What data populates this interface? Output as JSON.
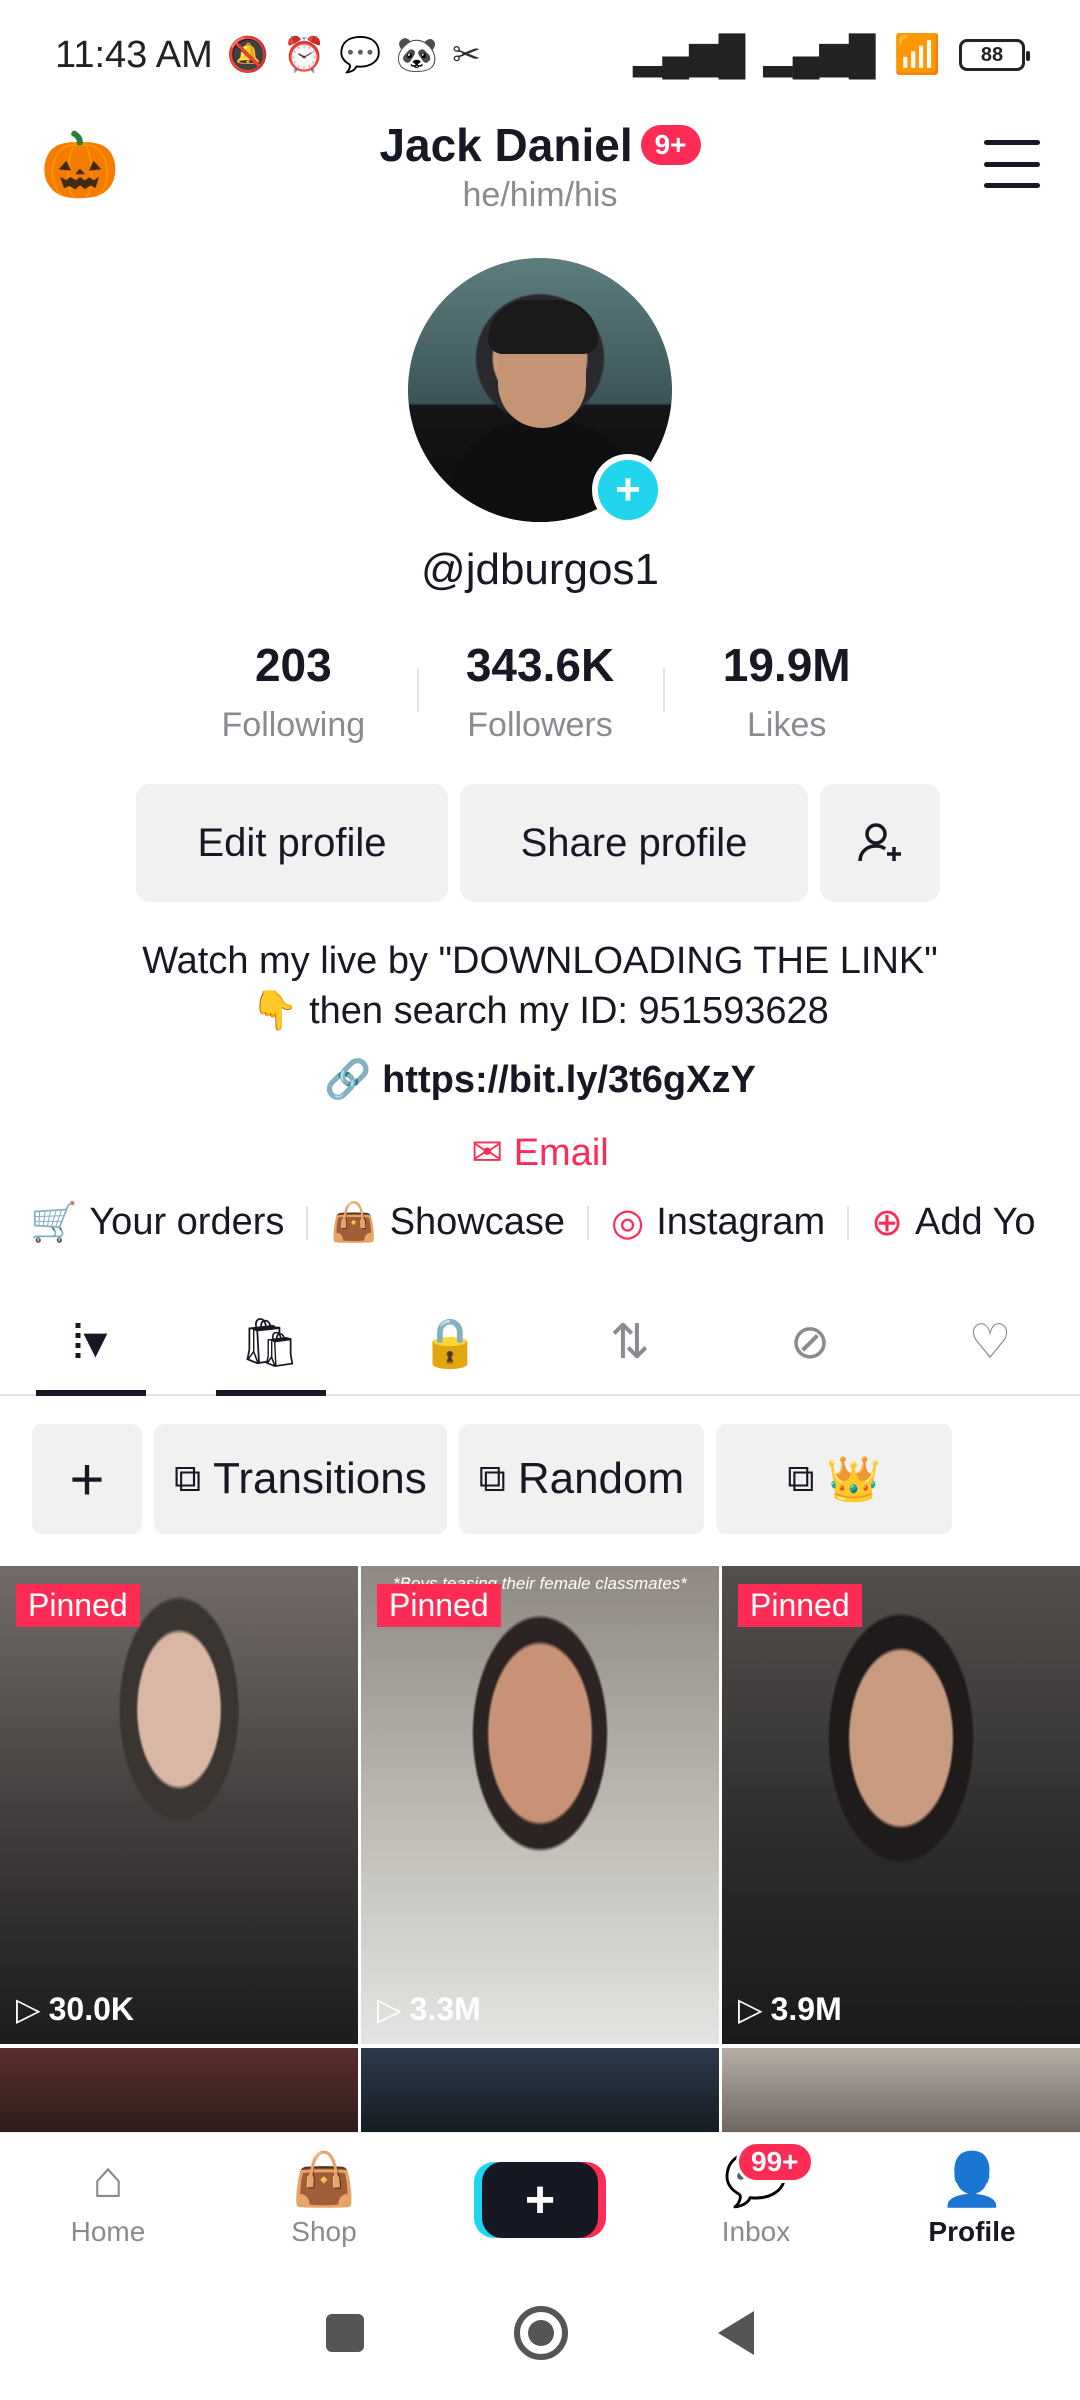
{
  "status_bar": {
    "time": "11:43 AM",
    "battery": "88"
  },
  "header": {
    "name": "Jack Daniel",
    "badge": "9+",
    "pronouns": "he/him/his",
    "left_emoji": "🎃"
  },
  "profile": {
    "handle": "@jdburgos1",
    "stats": [
      {
        "value": "203",
        "label": "Following"
      },
      {
        "value": "343.6K",
        "label": "Followers"
      },
      {
        "value": "19.9M",
        "label": "Likes"
      }
    ],
    "buttons": {
      "edit": "Edit profile",
      "share": "Share profile"
    },
    "bio_line1": "Watch my live by \"DOWNLOADING THE LINK\"",
    "bio_line2": "👇 then search my ID: 951593628",
    "link": "https://bit.ly/3t6gXzY",
    "email": "Email"
  },
  "quick_links": [
    {
      "label": "Your orders",
      "icon": "cart-icon"
    },
    {
      "label": "Showcase",
      "icon": "bag-icon"
    },
    {
      "label": "Instagram",
      "icon": "instagram-icon"
    },
    {
      "label": "Add Yo",
      "icon": "add-icon"
    }
  ],
  "collections": {
    "items": [
      "Transitions",
      "Random",
      "👑"
    ]
  },
  "videos": [
    {
      "pinned": "Pinned",
      "views": "30.0K",
      "caption": ""
    },
    {
      "pinned": "Pinned",
      "views": "3.3M",
      "caption": "*Boys teasing their female classmates*"
    },
    {
      "pinned": "Pinned",
      "views": "3.9M",
      "caption": ""
    }
  ],
  "bottom_nav": {
    "home": "Home",
    "shop": "Shop",
    "inbox": "Inbox",
    "inbox_badge": "99+",
    "profile": "Profile"
  },
  "colors": {
    "accent": "#fe2c55",
    "cyan": "#20d5ec",
    "text": "#161823",
    "muted": "#8a8b91"
  }
}
